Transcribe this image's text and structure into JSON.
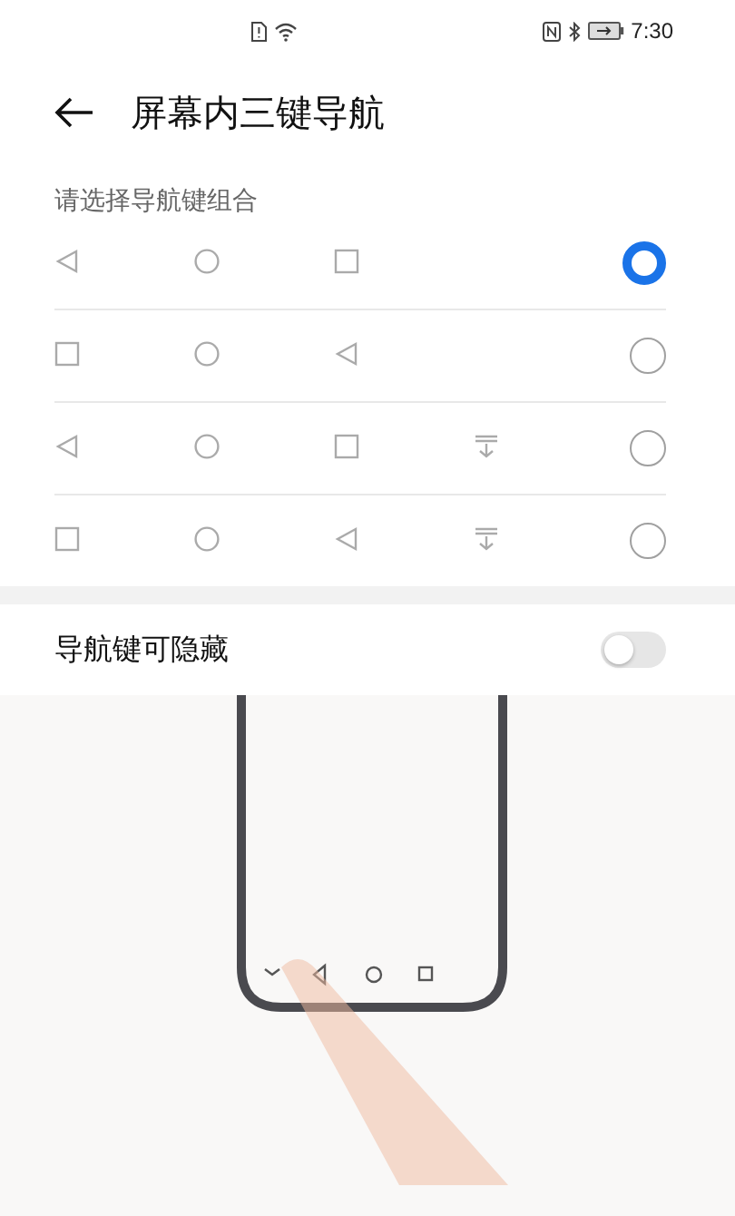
{
  "status_bar": {
    "time": "7:30"
  },
  "header": {
    "title": "屏幕内三键导航"
  },
  "section_label": "请选择导航键组合",
  "options": [
    {
      "keys": [
        {
          "kind": "back"
        },
        {
          "kind": "home"
        },
        {
          "kind": "recent"
        }
      ],
      "selected": true
    },
    {
      "keys": [
        {
          "kind": "recent"
        },
        {
          "kind": "home"
        },
        {
          "kind": "back"
        }
      ],
      "selected": false
    },
    {
      "keys": [
        {
          "kind": "back"
        },
        {
          "kind": "home"
        },
        {
          "kind": "recent"
        },
        {
          "kind": "hide"
        }
      ],
      "selected": false
    },
    {
      "keys": [
        {
          "kind": "recent"
        },
        {
          "kind": "home"
        },
        {
          "kind": "back"
        },
        {
          "kind": "hide"
        }
      ],
      "selected": false
    }
  ],
  "hide_toggle": {
    "label": "导航键可隐藏",
    "on": false
  }
}
